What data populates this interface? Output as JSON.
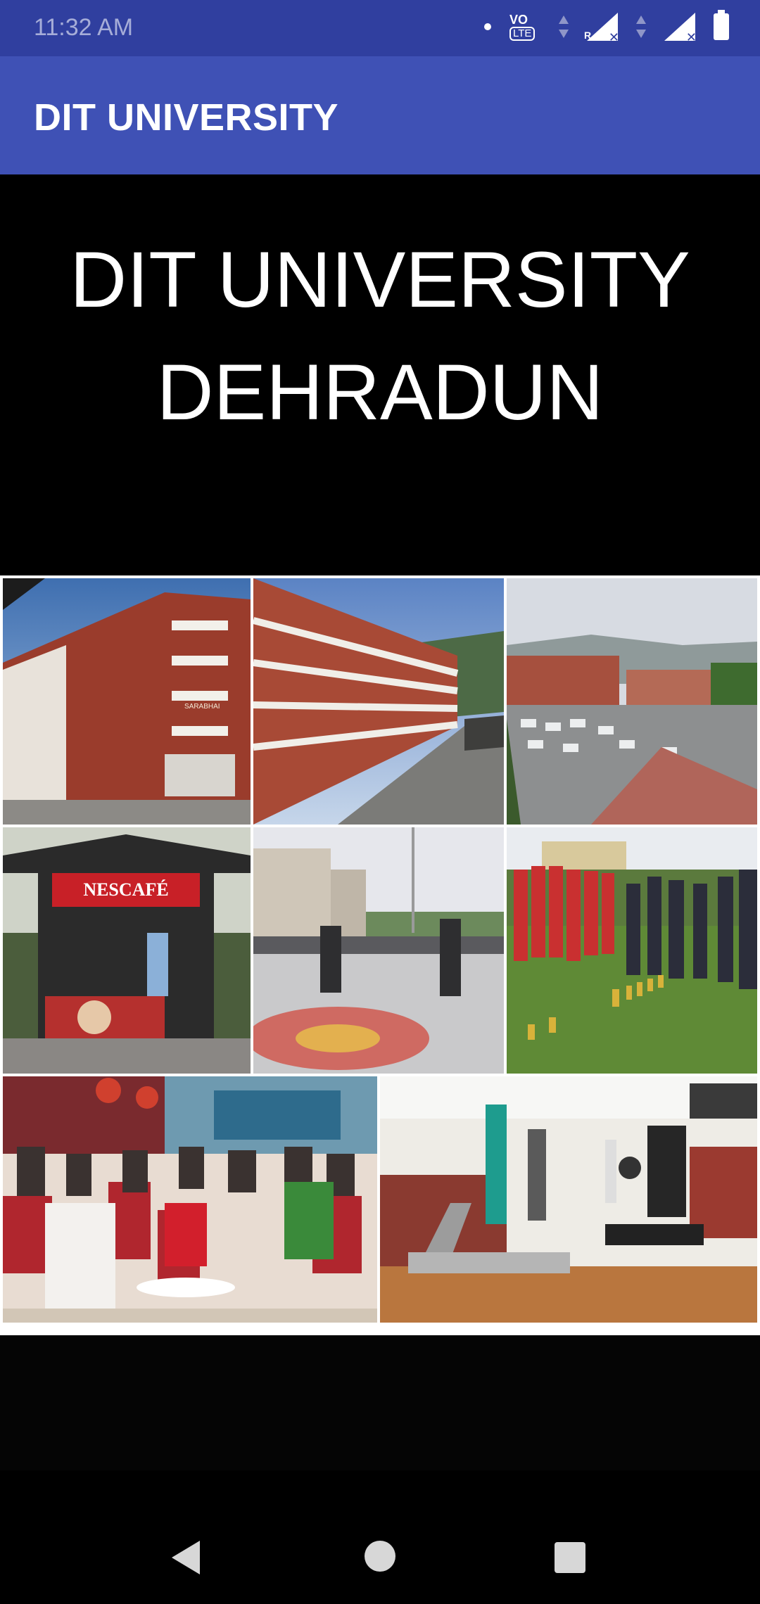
{
  "status_bar": {
    "time": "11:32 AM",
    "volte_top": "VO",
    "volte_bottom": "LTE",
    "roaming": "R",
    "icons": [
      "notification-dot-icon",
      "volte-icon",
      "data-arrows-icon",
      "signal-icon",
      "data-arrows-icon",
      "signal-icon",
      "battery-icon"
    ]
  },
  "app_bar": {
    "title": "DIT UNIVERSITY"
  },
  "hero": {
    "line1": "DIT UNIVERSITY",
    "line2": "DEHRADUN"
  },
  "gallery": {
    "photos": [
      {
        "name": "sarabhai-building",
        "sign": "SARABHAI"
      },
      {
        "name": "hostel-building"
      },
      {
        "name": "campus-parking"
      },
      {
        "name": "nescafe-kiosk",
        "sign": "NESCAFÉ"
      },
      {
        "name": "basketball-court"
      },
      {
        "name": "sports-team-trophies"
      },
      {
        "name": "cafeteria-students"
      },
      {
        "name": "gym"
      }
    ]
  },
  "nav_bar": {
    "icons": [
      "back-icon",
      "home-icon",
      "recent-apps-icon"
    ]
  }
}
